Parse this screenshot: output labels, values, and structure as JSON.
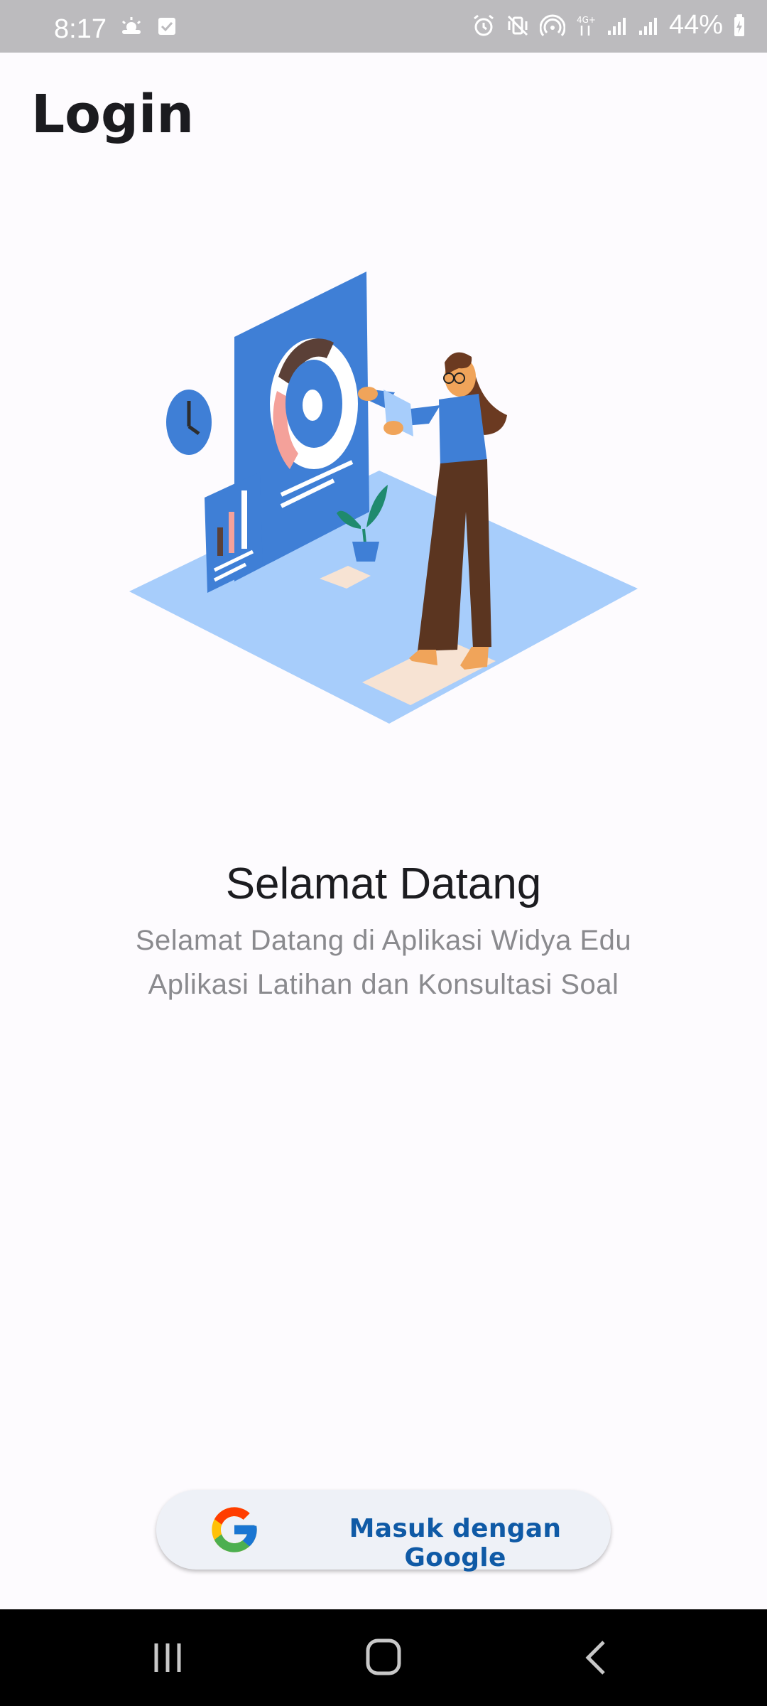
{
  "status_bar": {
    "time": "8:17",
    "battery": "44%",
    "left_icons": [
      "weather-icon",
      "check-box-icon"
    ],
    "right_icons": [
      "alarm-icon",
      "vibrate-icon",
      "hotspot-icon",
      "data-4g-icon",
      "signal-icon",
      "signal-icon",
      "battery-icon"
    ]
  },
  "header": {
    "title": "Login"
  },
  "welcome": {
    "title": "Selamat Datang",
    "subtitle_line1": "Selamat Datang di Aplikasi Widya Edu",
    "subtitle_line2": "Aplikasi Latihan dan Konsultasi Soal"
  },
  "login_button": {
    "label": "Masuk dengan Google",
    "icon": "google-icon"
  },
  "nav_bar": {
    "items": [
      "recent-apps-icon",
      "home-icon",
      "back-icon"
    ]
  },
  "colors": {
    "accent": "#0f5aa6",
    "illustration_blue": "#3f7fd6",
    "illustration_floor": "#a7cdfb",
    "background": "#fdfbfe"
  }
}
